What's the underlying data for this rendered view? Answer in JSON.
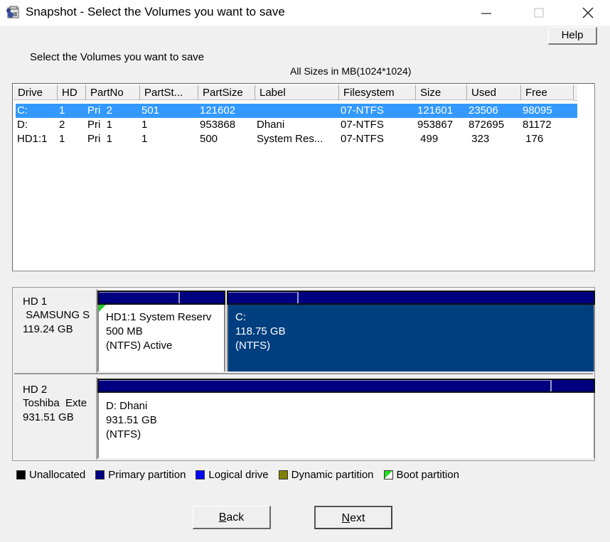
{
  "window": {
    "title": "Snapshot - Select the Volumes you want to save",
    "icon": "snapshot-app-icon",
    "controls": {
      "minimize": "—",
      "maximize": "☐",
      "close": "✕"
    }
  },
  "help_label": "Help",
  "intro_text": "Select the Volumes you want to save",
  "sizes_note": "All Sizes in MB(1024*1024)",
  "volume_list": {
    "columns": [
      "Drive",
      "HD",
      "PartNo",
      "PartSt...",
      "PartSize",
      "Label",
      "Filesystem",
      "Size",
      "Used",
      "Free"
    ],
    "rows": [
      {
        "drive": "C:",
        "hd": "1",
        "partno": "Pri  2",
        "partstart": "501",
        "partsize": "121602",
        "label": "",
        "filesystem": "07-NTFS",
        "size": "121601",
        "used": "23506",
        "free": "98095",
        "selected": true
      },
      {
        "drive": "D:",
        "hd": "2",
        "partno": "Pri  1",
        "partstart": "1",
        "partsize": "953868",
        "label": "Dhani",
        "filesystem": "07-NTFS",
        "size": "953867",
        "used": "872695",
        "free": "81172",
        "selected": false
      },
      {
        "drive": "HD1:1",
        "hd": "1",
        "partno": "Pri  1",
        "partstart": "1",
        "partsize": "500",
        "label": "System Res...",
        "filesystem": "07-NTFS",
        "size": " 499",
        "used": " 323",
        "free": " 176",
        "selected": false
      }
    ]
  },
  "disks": [
    {
      "name": "HD 1",
      "model": " SAMSUNG S",
      "capacity": "119.24 GB",
      "partitions": [
        {
          "line1": "HD1:1 System Reserv",
          "line2": "500 MB",
          "line3": "(NTFS) Active",
          "used_fraction": 0.646,
          "boot": true,
          "selected": false
        },
        {
          "line1": "C:",
          "line2": "118.75 GB",
          "line3": "(NTFS)",
          "used_fraction": 0.193,
          "boot": false,
          "selected": true
        }
      ]
    },
    {
      "name": "HD 2",
      "model": "Toshiba  Exte",
      "capacity": "931.51 GB",
      "partitions": [
        {
          "line1": "D: Dhani",
          "line2": "931.51 GB",
          "line3": "(NTFS)",
          "used_fraction": 0.915,
          "boot": false,
          "selected": false
        }
      ]
    }
  ],
  "legend": [
    {
      "label": "Unallocated",
      "color": "#000000"
    },
    {
      "label": "Primary partition",
      "color": "#000080"
    },
    {
      "label": "Logical drive",
      "color": "#0000ff"
    },
    {
      "label": "Dynamic partition",
      "color": "#808000"
    },
    {
      "label": "Boot partition",
      "color": "boot"
    }
  ],
  "buttons": {
    "back": {
      "mnemonic": "B",
      "rest": "ack"
    },
    "next": {
      "mnemonic": "N",
      "rest": "ext"
    }
  },
  "colors": {
    "selection": "#3399ff",
    "selected_partition": "#003f7f",
    "primary_bar": "#000080",
    "boot_flag": "#22cc22"
  }
}
